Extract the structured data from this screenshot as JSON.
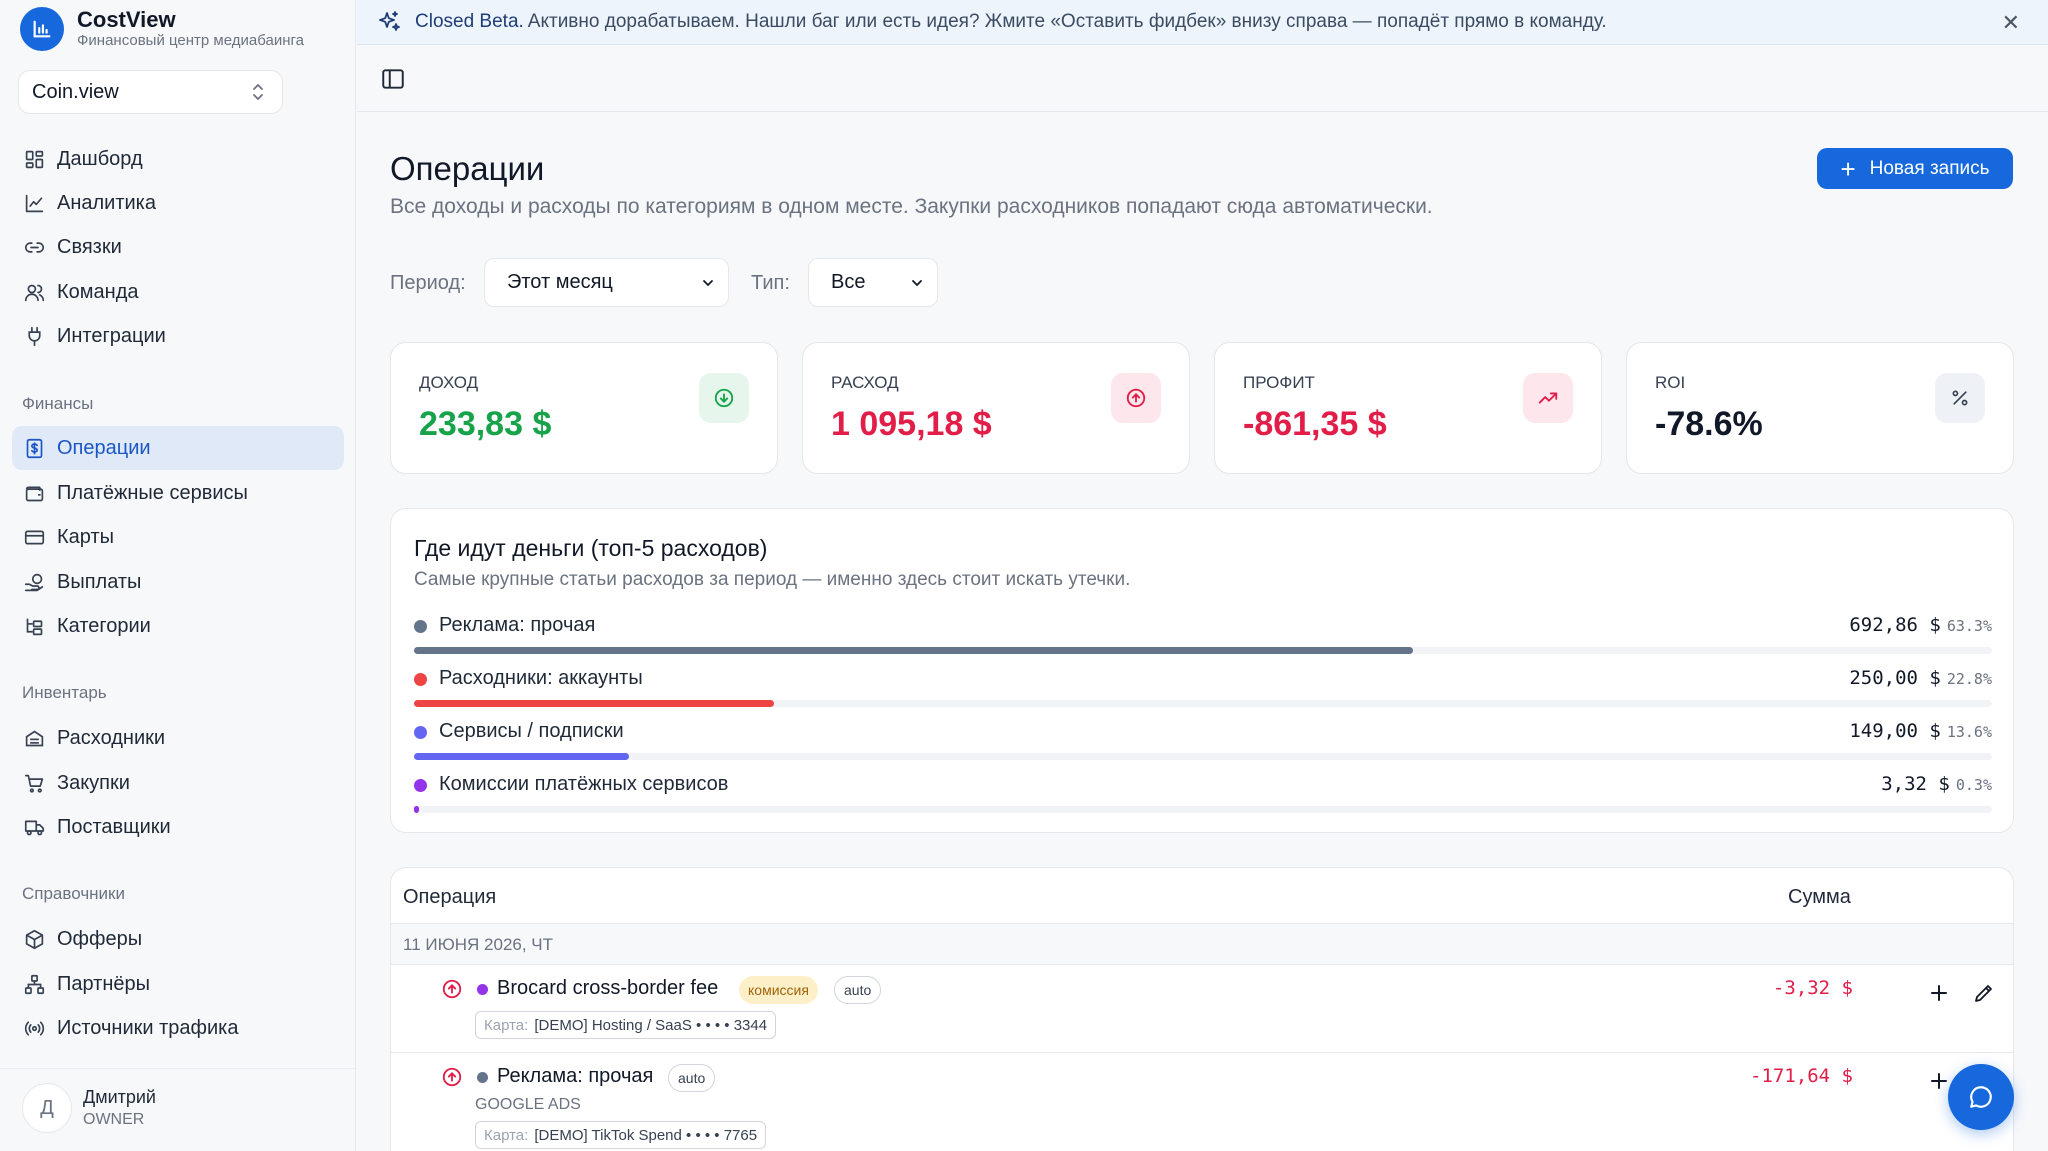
{
  "brand": {
    "name": "CostView",
    "subtitle": "Финансовый центр медиабаинга"
  },
  "workspace": {
    "value": "Coin.view"
  },
  "sidebar": {
    "main": [
      {
        "label": "Дашборд",
        "icon": "dashboard-icon"
      },
      {
        "label": "Аналитика",
        "icon": "chart-line-icon"
      },
      {
        "label": "Связки",
        "icon": "link-icon"
      },
      {
        "label": "Команда",
        "icon": "users-icon"
      },
      {
        "label": "Интеграции",
        "icon": "plug-icon"
      }
    ],
    "finance_title": "Финансы",
    "finance": [
      {
        "label": "Операции",
        "icon": "receipt-icon",
        "active": true
      },
      {
        "label": "Платёжные сервисы",
        "icon": "wallet-icon"
      },
      {
        "label": "Карты",
        "icon": "credit-card-icon"
      },
      {
        "label": "Выплаты",
        "icon": "payout-icon"
      },
      {
        "label": "Категории",
        "icon": "tree-icon"
      }
    ],
    "inventory_title": "Инвентарь",
    "inventory": [
      {
        "label": "Расходники",
        "icon": "archive-icon"
      },
      {
        "label": "Закупки",
        "icon": "cart-icon"
      },
      {
        "label": "Поставщики",
        "icon": "truck-icon"
      }
    ],
    "refs_title": "Справочники",
    "refs": [
      {
        "label": "Офферы",
        "icon": "box-icon"
      },
      {
        "label": "Партнёры",
        "icon": "network-icon"
      },
      {
        "label": "Источники трафика",
        "icon": "radio-icon"
      }
    ]
  },
  "user": {
    "initial": "Д",
    "name": "Дмитрий",
    "role": "OWNER"
  },
  "banner": {
    "strong": "Closed Beta.",
    "text": "Активно дорабатываем. Нашли баг или есть идея? Жмите «Оставить фидбек» внизу справа — попадёт прямо в команду."
  },
  "page": {
    "title": "Операции",
    "subtitle": "Все доходы и расходы по категориям в одном месте. Закупки расходников попадают сюда автоматически.",
    "new_button": "Новая запись"
  },
  "filters": {
    "period_label": "Период:",
    "period_value": "Этот месяц",
    "type_label": "Тип:",
    "type_value": "Все"
  },
  "stats": [
    {
      "label": "ДОХОД",
      "value": "233,83 $",
      "color": "#16a34a",
      "icon": "arrow-down-circle-icon"
    },
    {
      "label": "РАСХОД",
      "value": "1 095,18 $",
      "color": "#e11d48",
      "icon": "arrow-up-circle-icon"
    },
    {
      "label": "ПРОФИТ",
      "value": "-861,35 $",
      "color": "#e11d48",
      "icon": "trend-up-icon"
    },
    {
      "label": "ROI",
      "value": "-78.6%",
      "color": "#111827",
      "icon": "percent-icon"
    }
  ],
  "top5": {
    "title": "Где идут деньги (топ-5 расходов)",
    "subtitle": "Самые крупные статьи расходов за период — именно здесь стоит искать утечки.",
    "items": [
      {
        "label": "Реклама: прочая",
        "amount": "692,86 $",
        "pct": "63.3%",
        "share": 0.633,
        "color": "#64748b"
      },
      {
        "label": "Расходники: аккаунты",
        "amount": "250,00 $",
        "pct": "22.8%",
        "share": 0.228,
        "color": "#ef4444"
      },
      {
        "label": "Сервисы / подписки",
        "amount": "149,00 $",
        "pct": "13.6%",
        "share": 0.136,
        "color": "#6366f1"
      },
      {
        "label": "Комиссии платёжных сервисов",
        "amount": "3,32 $",
        "pct": "0.3%",
        "share": 0.003,
        "color": "#9333ea"
      }
    ]
  },
  "ops": {
    "col_operation": "Операция",
    "col_amount": "Сумма",
    "date": "11 ИЮНЯ 2026, ЧТ",
    "rows": [
      {
        "name": "Brocard cross-border fee",
        "badge_fee": "комиссия",
        "badge_auto": "auto",
        "card_key": "Карта:",
        "card_value": "[DEMO] Hosting / SaaS • • • • 3344",
        "amount": "-3,32 $",
        "dot": "#9333ea"
      },
      {
        "name": "Реклама: прочая",
        "badge_auto": "auto",
        "source": "GOOGLE ADS",
        "card_key": "Карта:",
        "card_value": "[DEMO] TikTok Spend • • • • 7765",
        "amount": "-171,64 $",
        "dot": "#64748b"
      }
    ]
  }
}
